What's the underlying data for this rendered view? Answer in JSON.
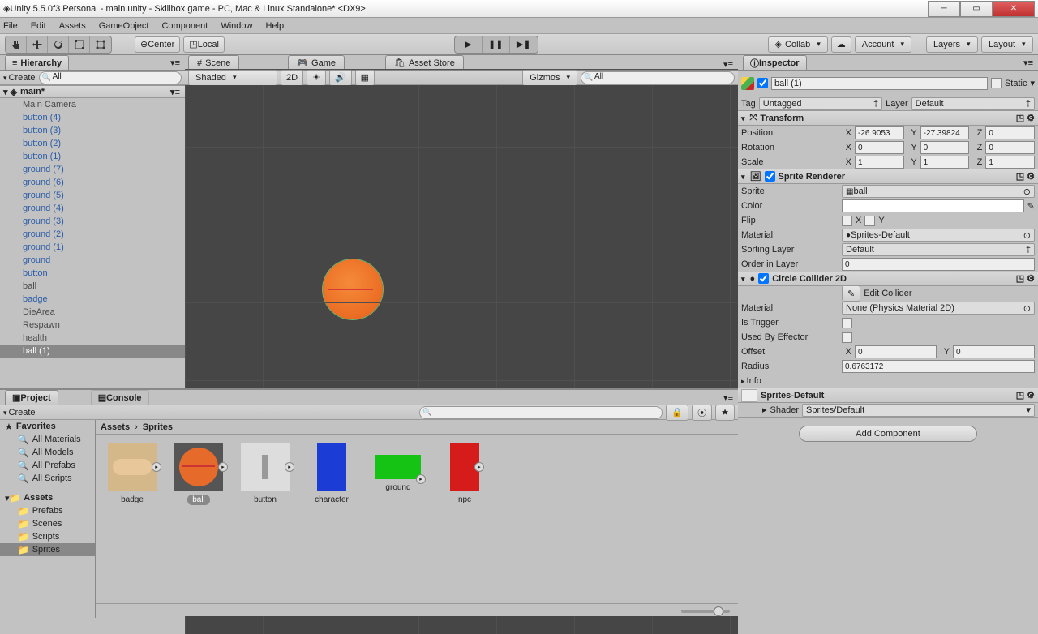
{
  "window": {
    "title": "Unity 5.5.0f3 Personal - main.unity - Skillbox game - PC, Mac & Linux Standalone* <DX9>"
  },
  "menu": [
    "File",
    "Edit",
    "Assets",
    "GameObject",
    "Component",
    "Window",
    "Help"
  ],
  "toolbar": {
    "center": "Center",
    "local": "Local",
    "collab": "Collab",
    "account": "Account",
    "layers": "Layers",
    "layout": "Layout"
  },
  "hierarchy": {
    "title": "Hierarchy",
    "create": "Create",
    "scene": "main*",
    "items": [
      {
        "name": "Main Camera",
        "blue": false
      },
      {
        "name": "button (4)",
        "blue": true
      },
      {
        "name": "button (3)",
        "blue": true
      },
      {
        "name": "button (2)",
        "blue": true
      },
      {
        "name": "button (1)",
        "blue": true
      },
      {
        "name": "ground (7)",
        "blue": true
      },
      {
        "name": "ground (6)",
        "blue": true
      },
      {
        "name": "ground (5)",
        "blue": true
      },
      {
        "name": "ground (4)",
        "blue": true
      },
      {
        "name": "ground (3)",
        "blue": true
      },
      {
        "name": "ground (2)",
        "blue": true
      },
      {
        "name": "ground (1)",
        "blue": true
      },
      {
        "name": "ground",
        "blue": true
      },
      {
        "name": "button",
        "blue": true
      },
      {
        "name": "ball",
        "blue": false
      },
      {
        "name": "badge",
        "blue": true
      },
      {
        "name": "DieArea",
        "blue": false
      },
      {
        "name": "Respawn",
        "blue": false
      },
      {
        "name": "health",
        "blue": false
      },
      {
        "name": "ball (1)",
        "blue": false,
        "selected": true
      }
    ]
  },
  "scene": {
    "tabs": {
      "scene": "Scene",
      "game": "Game",
      "asset": "Asset Store"
    },
    "shaded": "Shaded",
    "mode2d": "2D",
    "gizmos": "Gizmos"
  },
  "project": {
    "title": "Project",
    "console": "Console",
    "create": "Create",
    "favorites": "Favorites",
    "favitems": [
      "All Materials",
      "All Models",
      "All Prefabs",
      "All Scripts"
    ],
    "assets": "Assets",
    "folders": [
      "Prefabs",
      "Scenes",
      "Scripts",
      "Sprites"
    ],
    "breadcrumb": [
      "Assets",
      "Sprites"
    ],
    "items": [
      "badge",
      "ball",
      "button",
      "character",
      "ground",
      "npc"
    ]
  },
  "inspector": {
    "title": "Inspector",
    "objname": "ball (1)",
    "static": "Static",
    "tag": "Tag",
    "tagval": "Untagged",
    "layer": "Layer",
    "layerval": "Default",
    "transform": {
      "title": "Transform",
      "position": "Position",
      "rotation": "Rotation",
      "scale": "Scale",
      "px": "-26.9053",
      "py": "-27.39824",
      "pz": "0",
      "rx": "0",
      "ry": "0",
      "rz": "0",
      "sx": "1",
      "sy": "1",
      "sz": "1"
    },
    "sprite": {
      "title": "Sprite Renderer",
      "sprite": "Sprite",
      "spriteval": "ball",
      "color": "Color",
      "flip": "Flip",
      "flipx": "X",
      "flipy": "Y",
      "material": "Material",
      "materialval": "Sprites-Default",
      "sorting": "Sorting Layer",
      "sortingval": "Default",
      "order": "Order in Layer",
      "orderval": "0"
    },
    "collider": {
      "title": "Circle Collider 2D",
      "edit": "Edit Collider",
      "material": "Material",
      "materialval": "None (Physics Material 2D)",
      "trigger": "Is Trigger",
      "effector": "Used By Effector",
      "offset": "Offset",
      "ox": "0",
      "oy": "0",
      "radius": "Radius",
      "radiusval": "0.6763172"
    },
    "info": "Info",
    "matpreview": {
      "name": "Sprites-Default",
      "shader": "Shader",
      "shaderval": "Sprites/Default"
    },
    "addcomp": "Add Component"
  }
}
